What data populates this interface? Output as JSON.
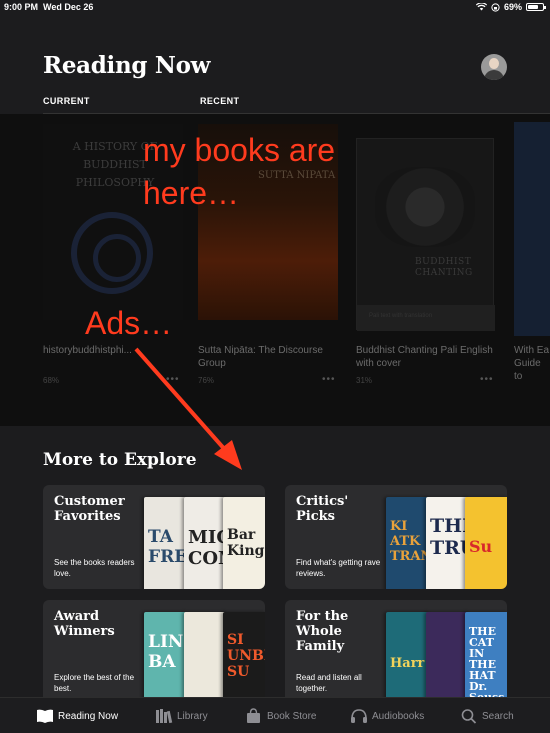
{
  "status_bar": {
    "time": "9:00 PM",
    "date": "Wed Dec 26",
    "battery": "69%",
    "battery_level": 0.69
  },
  "header": {
    "title": "Reading Now"
  },
  "sections": {
    "current": "CURRENT",
    "recent": "RECENT"
  },
  "shelf": {
    "books": [
      {
        "cover_text": "A HISTORY OF BUDDHIST PHILOSOPHY",
        "title": "historybuddhistphi...",
        "progress": "68%"
      },
      {
        "cover_text": "SUTTA NIPATA",
        "title": "Sutta Nipāta: The Discourse Group",
        "progress": "76%"
      },
      {
        "cover_text": "BUDDHIST CHANTING",
        "cover_band": "Pali text with translation",
        "title": "Buddhist Chanting Pali English with cover",
        "progress": "31%"
      },
      {
        "title": "With Ea Guide to"
      }
    ],
    "more_label": "•••"
  },
  "annotations": {
    "books": "my books are here…",
    "ads": "Ads…",
    "color": "#ff3b1e"
  },
  "explore": {
    "title": "More to Explore",
    "cards": [
      {
        "title": "Customer Favorites",
        "subtitle": "See the books readers love."
      },
      {
        "title": "Critics' Picks",
        "subtitle": "Find what's getting rave reviews."
      },
      {
        "title": "Award Winners",
        "subtitle": "Explore the best of the best."
      },
      {
        "title": "For the Whole Family",
        "subtitle": "Read and listen all together."
      }
    ],
    "card_books": {
      "customer": [
        "TA FRE",
        "MIC COM",
        "Bar King"
      ],
      "critics": [
        "KI ATK TRANS",
        "THI TRU",
        "Su"
      ],
      "award": [
        "LIN BA",
        "",
        "SI UNBE SU"
      ],
      "family": [
        "Harr",
        "",
        "THE CAT IN THE HAT Dr. Seuss"
      ]
    }
  },
  "tabbar": {
    "items": [
      {
        "label": "Reading Now",
        "icon": "book-open-icon",
        "active": true
      },
      {
        "label": "Library",
        "icon": "library-icon"
      },
      {
        "label": "Book Store",
        "icon": "shopping-bag-icon"
      },
      {
        "label": "Audiobooks",
        "icon": "headphones-icon"
      },
      {
        "label": "Search",
        "icon": "search-icon"
      }
    ]
  }
}
